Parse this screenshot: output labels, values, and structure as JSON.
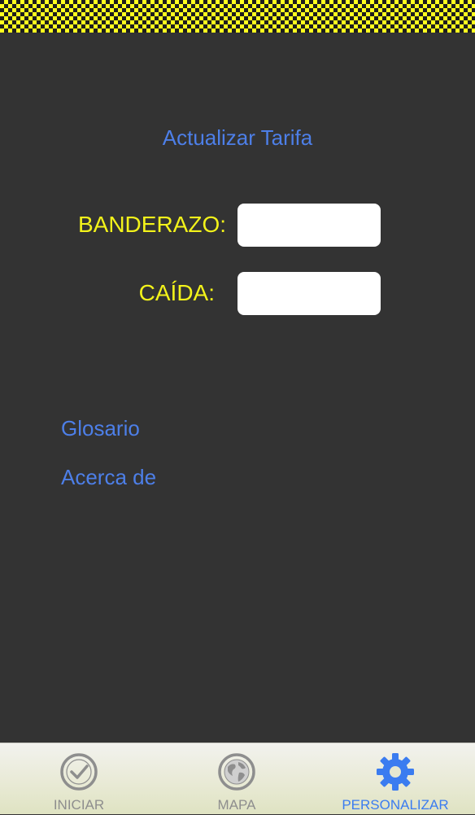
{
  "tarifa": {
    "update_link": "Actualizar Tarifa",
    "banderazo_label": "BANDERAZO:",
    "banderazo_value": "",
    "caida_label": "CAÍDA:",
    "caida_value": ""
  },
  "links": {
    "glosario": "Glosario",
    "acerca": "Acerca de"
  },
  "tabbar": {
    "tabs": [
      {
        "label": "INICIAR",
        "icon": "checkmark-clock-icon",
        "selected": false
      },
      {
        "label": "MAPA",
        "icon": "globe-icon",
        "selected": false
      },
      {
        "label": "PERSONALIZAR",
        "icon": "gear-icon",
        "selected": true
      }
    ]
  },
  "colors": {
    "background": "#333333",
    "checker_yellow": "#ffff1e",
    "label_yellow": "#f3f31a",
    "link_blue": "#4d7fe8",
    "tab_selected": "#3b7cf0",
    "tab_inactive": "#8e8e8e"
  }
}
